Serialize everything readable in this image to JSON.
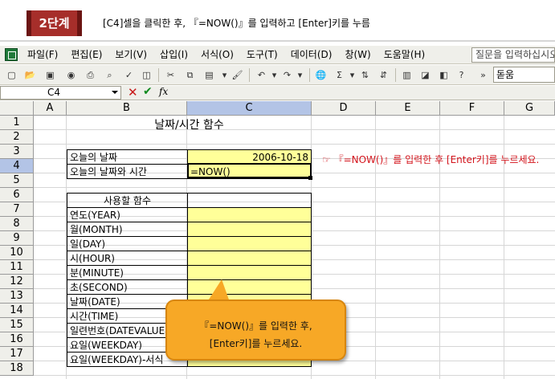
{
  "banner": {
    "step": "2단계",
    "instruction": "[C4]셀을 클릭한 후, 『=NOW()』를 입력하고 [Enter]키를 누름"
  },
  "menubar": {
    "items": [
      "파일(F)",
      "편집(E)",
      "보기(V)",
      "삽입(I)",
      "서식(O)",
      "도구(T)",
      "데이터(D)",
      "창(W)",
      "도움말(H)"
    ],
    "help_placeholder": "질문을 입력하십시오"
  },
  "toolbar": {
    "font_name": "돋움"
  },
  "formula_bar": {
    "name_box": "C4",
    "fx_label": "fx",
    "cancel_icon": "x-icon",
    "enter_icon": "check-icon"
  },
  "grid": {
    "columns": [
      "A",
      "B",
      "C",
      "D",
      "E",
      "F",
      "G"
    ],
    "rows": [
      "1",
      "2",
      "3",
      "4",
      "5",
      "6",
      "7",
      "8",
      "9",
      "10",
      "11",
      "12",
      "13",
      "14",
      "15",
      "16",
      "17",
      "18"
    ],
    "selected_column": "C",
    "selected_row": "4"
  },
  "sheet": {
    "title": "날짜/시간 함수",
    "today_label": "오늘의 날짜",
    "today_value": "2006-10-18",
    "now_label": "오늘의 날짜와 시간",
    "now_value": "=NOW()",
    "functions_header": "사용할 함수",
    "functions": [
      "연도(YEAR)",
      "월(MONTH)",
      "일(DAY)",
      "시(HOUR)",
      "분(MINUTE)",
      "초(SECOND)",
      "날짜(DATE)",
      "시간(TIME)",
      "일련번호(DATEVALUE)",
      "요일(WEEKDAY)",
      "요일(WEEKDAY)-서식"
    ]
  },
  "note": "☞ 『=NOW()』를 입력한 후 [Enter키]를 누르세요.",
  "callout": {
    "line1": "『=NOW()』를 입력한 후,",
    "line2": "[Enter키]를 누르세요."
  },
  "colors": {
    "step_badge": "#a62e2a",
    "highlight_yellow": "#ffff99",
    "note_red": "#d4141c",
    "callout_orange": "#f7a826",
    "selected_header": "#b3c4e6"
  }
}
